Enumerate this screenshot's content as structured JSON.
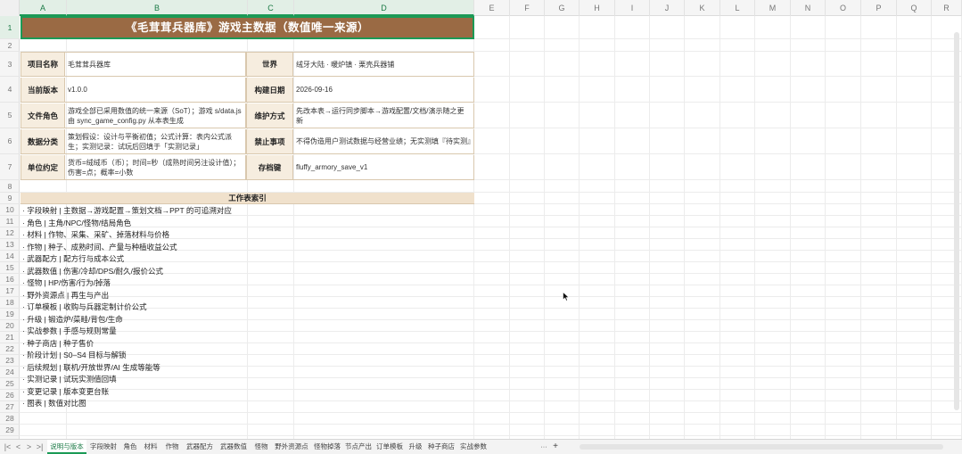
{
  "columns": [
    "A",
    "B",
    "C",
    "D",
    "E",
    "F",
    "G",
    "H",
    "I",
    "J",
    "K",
    "L",
    "M",
    "N",
    "O",
    "P",
    "Q",
    "R"
  ],
  "selected_columns": [
    "A",
    "B",
    "C",
    "D"
  ],
  "rows": [
    "1",
    "2",
    "3",
    "4",
    "5",
    "6",
    "7",
    "8",
    "9",
    "10",
    "11",
    "12",
    "13",
    "14",
    "15",
    "16",
    "17",
    "18",
    "19",
    "20",
    "21",
    "22",
    "23",
    "24",
    "25",
    "26",
    "27",
    "28",
    "29"
  ],
  "title": "《毛茸茸兵器库》游戏主数据（数值唯一来源）",
  "info": [
    {
      "l1": "项目名称",
      "v1": "毛茸茸兵器库",
      "l2": "世界",
      "v2": "绒牙大陆 · 暖炉镇 · 栗壳兵器铺"
    },
    {
      "l1": "当前版本",
      "v1": "v1.0.0",
      "l2": "构建日期",
      "v2": "2026-09-16"
    },
    {
      "l1": "文件角色",
      "v1": "游戏全部已采用数值的统一来源（SoT）；游戏 s/data.js 由 sync_game_config.py 从本表生成",
      "l2": "维护方式",
      "v2": "先改本表→运行同步脚本→游戏配置/文档/演示随之更新"
    },
    {
      "l1": "数据分类",
      "v1": "策划假设：设计与平衡初值；公式计算：表内公式派生；实测记录：试玩后回填于「实测记录」",
      "l2": "禁止事项",
      "v2": "不得伪造用户测试数据与经营业绩；无实测填『待实测』"
    },
    {
      "l1": "单位约定",
      "v1": "货币=绒绒币（币）；时间=秒（成熟时间另注设计值）；伤害=点；概率=小数",
      "l2": "存档键",
      "v2": "fluffy_armory_save_v1"
    }
  ],
  "index_title": "工作表索引",
  "index": [
    "· 字段映射 | 主数据→游戏配置→策划文档→PPT 的可追溯对应",
    "· 角色 | 主角/NPC/怪物/结局角色",
    "· 材料 | 作物、采集、采矿、掉落材料与价格",
    "· 作物 | 种子、成熟时间、产量与种植收益公式",
    "· 武器配方 | 配方行与成本公式",
    "· 武器数值 | 伤害/冷却/DPS/耐久/报价公式",
    "· 怪物 | HP/伤害/行为/掉落",
    "· 野外资源点 | 再生与产出",
    "· 订单模板 | 收购与兵器定制计价公式",
    "· 升级 | 锻造炉/菜畦/背包/生命",
    "· 实战参数 | 手感与规则常量",
    "· 种子商店 | 种子售价",
    "· 阶段计划 | S0–S4 目标与解锁",
    "· 后续规划 | 联机/开放世界/AI 生成等能等",
    "· 实测记录 | 试玩实测值回填",
    "· 变更记录 | 版本变更台账",
    "· 图表 | 数值对比图"
  ],
  "sheet_tabs": [
    "说明与版本",
    "字段映射",
    "角色",
    "材料",
    "作物",
    "武器配方",
    "武器数值",
    "怪物",
    "野外资源点",
    "怪物掉落",
    "节点产出",
    "订单模板",
    "升级",
    "种子商店",
    "实战参数"
  ],
  "active_tab": "说明与版本",
  "tab_nav": [
    "|<",
    "<",
    ">",
    ">|"
  ],
  "tab_more": "···",
  "tab_add": "+"
}
